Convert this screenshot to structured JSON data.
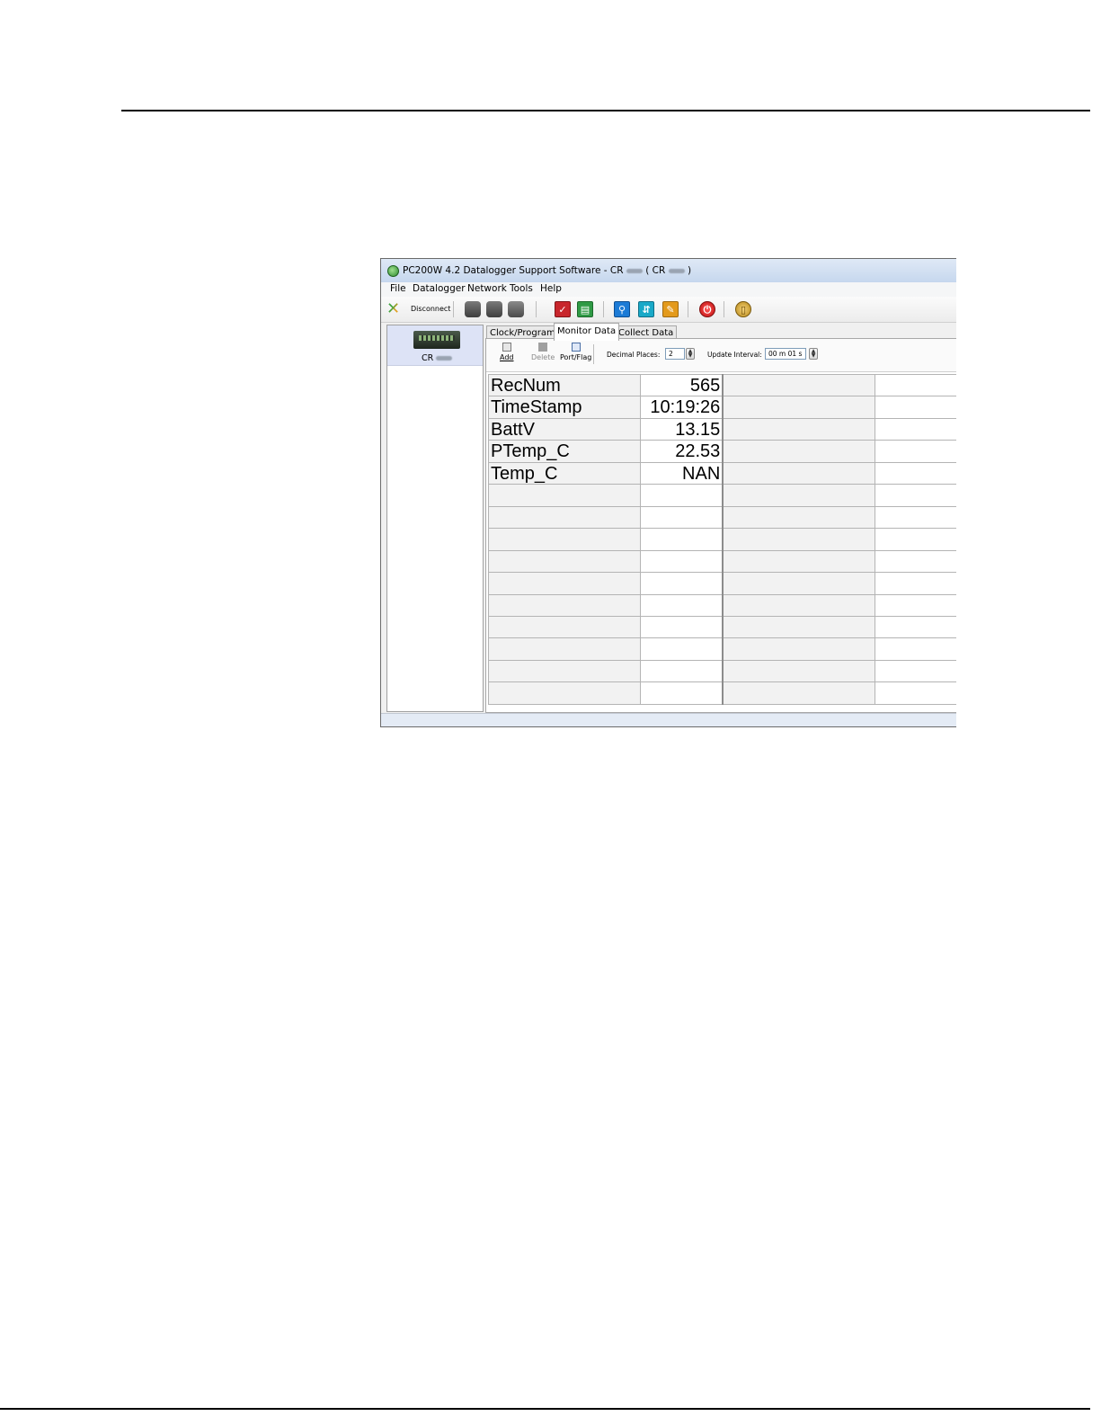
{
  "window": {
    "title_prefix": "PC200W 4.2 Datalogger Support Software - CR",
    "title_mid": " ( CR",
    "title_suffix": " )"
  },
  "menu": [
    "File",
    "Datalogger",
    "Network",
    "Tools",
    "Help"
  ],
  "toolbar": {
    "disconnect_label": "Disconnect"
  },
  "station": {
    "label": "CR"
  },
  "tabs": [
    "Clock/Program",
    "Monitor Data",
    "Collect Data"
  ],
  "active_tab": "Monitor Data",
  "monitor": {
    "add_label": "Add",
    "delete_label": "Delete",
    "portflag_label": "Port/Flag",
    "decimal_places_label": "Decimal Places:",
    "decimal_places_value": "2",
    "update_interval_label": "Update Interval:",
    "update_interval_value": "00 m 01 s"
  },
  "rows": [
    {
      "name": "RecNum",
      "value": "565"
    },
    {
      "name": "TimeStamp",
      "value": "10:19:26"
    },
    {
      "name": "BattV",
      "value": "13.15"
    },
    {
      "name": "PTemp_C",
      "value": "22.53"
    },
    {
      "name": "Temp_C",
      "value": "NAN"
    },
    {
      "name": "",
      "value": ""
    },
    {
      "name": "",
      "value": ""
    },
    {
      "name": "",
      "value": ""
    },
    {
      "name": "",
      "value": ""
    },
    {
      "name": "",
      "value": ""
    },
    {
      "name": "",
      "value": ""
    },
    {
      "name": "",
      "value": ""
    },
    {
      "name": "",
      "value": ""
    },
    {
      "name": "",
      "value": ""
    },
    {
      "name": "",
      "value": ""
    }
  ]
}
